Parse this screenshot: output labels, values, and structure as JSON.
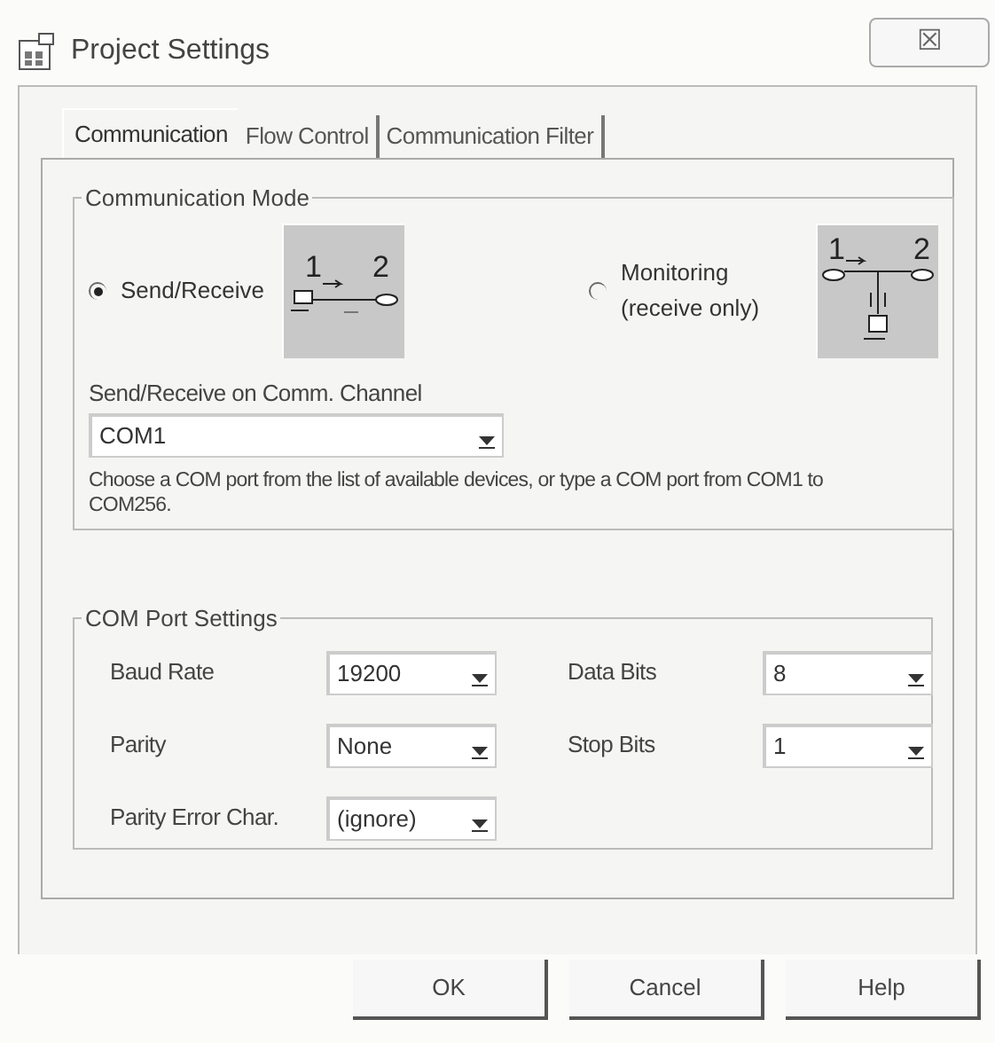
{
  "window": {
    "title": "Project Settings",
    "close_glyph": "☒"
  },
  "tabs": [
    {
      "label": "Communication",
      "selected": true
    },
    {
      "label": "Flow Control",
      "selected": false
    },
    {
      "label": "Communication Filter",
      "selected": false
    }
  ],
  "communication_mode": {
    "title": "Communication Mode",
    "options": [
      {
        "label": "Send/Receive",
        "selected": true,
        "kind": "direct",
        "diagram_labels": [
          "1",
          "2"
        ]
      },
      {
        "label": "Monitoring\n(receive only)",
        "selected": false,
        "kind": "monitor",
        "diagram_labels": [
          "1",
          "2"
        ]
      }
    ],
    "channel_label": "Send/Receive on Comm. Channel",
    "channel_value": "COM1",
    "hint": "Choose a COM port from the list of available devices, or type a COM port from COM1 to COM256."
  },
  "com_port_settings": {
    "title": "COM Port Settings",
    "fields": [
      {
        "label": "Baud Rate",
        "value": "19200"
      },
      {
        "label": "Data Bits",
        "value": "8"
      },
      {
        "label": "Parity",
        "value": "None"
      },
      {
        "label": "Stop Bits",
        "value": "1"
      },
      {
        "label": "Parity Error Char.",
        "value": "(ignore)"
      }
    ]
  },
  "buttons": [
    "OK",
    "Cancel",
    "Help"
  ]
}
